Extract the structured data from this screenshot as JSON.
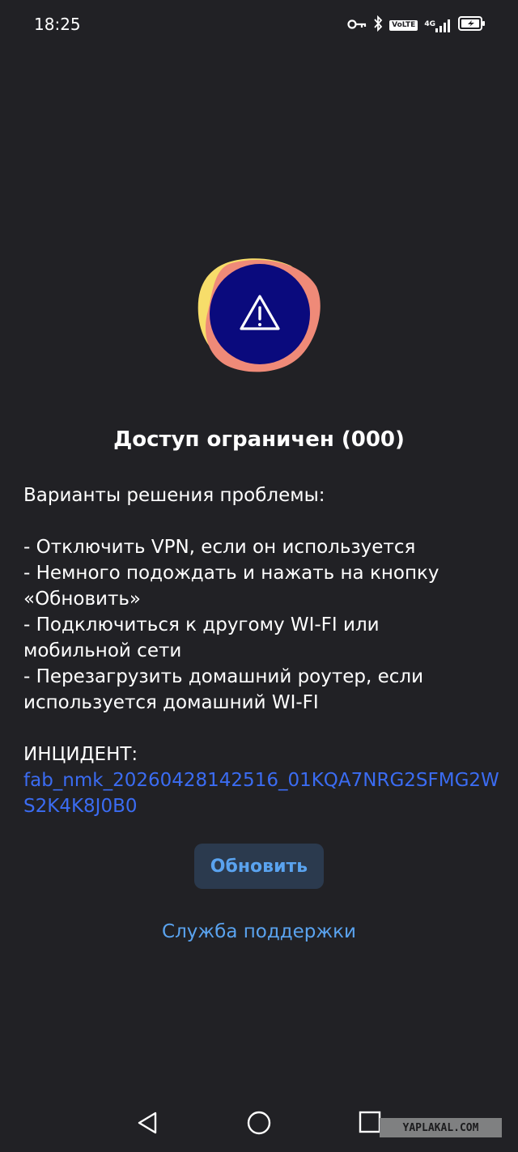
{
  "status_bar": {
    "time": "18:25",
    "icons": [
      "vpn-key-icon",
      "bluetooth-icon",
      "volte-icon",
      "signal-icon",
      "battery-charging-icon"
    ],
    "volte_label": "VoLTE",
    "network_label": "4G"
  },
  "illustration": {
    "icon": "warning-triangle-icon",
    "colors": {
      "circle": "#0a0a7d",
      "blob_back": "#f7dd6a",
      "blob_front": "#ef8a78"
    }
  },
  "title": "Доступ ограничен (000)",
  "solutions": {
    "heading": "Варианты решения проблемы:",
    "lines": [
      "- Отключить VPN, если он используется",
      "- Немного подождать и нажать на кнопку",
      "«Обновить»",
      "- Подключиться к другому WI-FI или",
      "мобильной сети",
      "- Перезагрузить домашний роутер, если",
      "используется домашний WI-FI"
    ]
  },
  "incident": {
    "label": "ИНЦИДЕНТ:",
    "id": "fab_nmk_20260428142516_01KQA7NRG2SFMG2WS2K4K8J0B0"
  },
  "actions": {
    "refresh_label": "Обновить",
    "support_label": "Служба поддержки"
  },
  "nav_bar": {
    "buttons": [
      "back-icon",
      "home-icon",
      "recents-icon"
    ]
  },
  "watermark": "YAPLAKAL.COM",
  "colors": {
    "background": "#212125",
    "link": "#3b6cf2",
    "accent": "#5aa3ef",
    "button_bg": "#2b3a4e"
  }
}
